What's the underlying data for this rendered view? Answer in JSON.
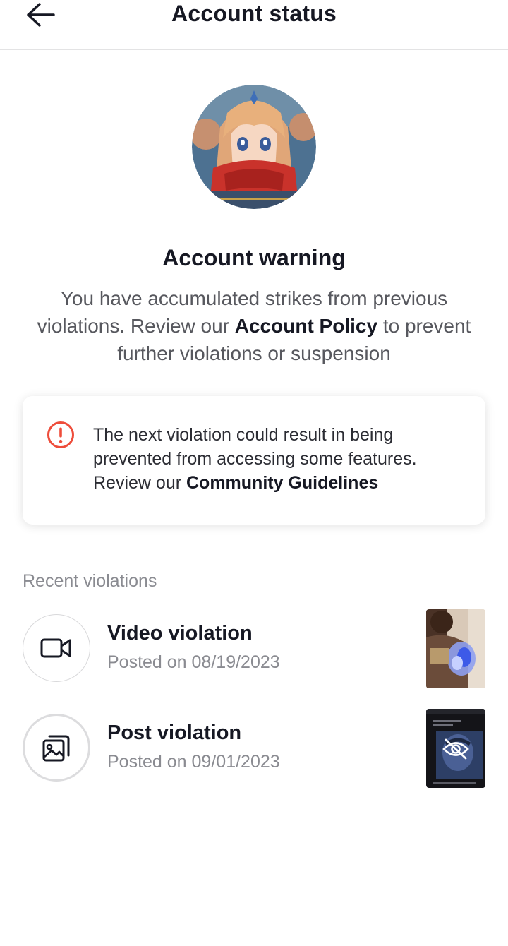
{
  "header": {
    "title": "Account status",
    "back_icon": "arrow-left-icon"
  },
  "avatar": {
    "icon": "anime-avatar"
  },
  "warning": {
    "title": "Account warning",
    "desc_part1": "You have accumulated strikes from previous violations. Review our ",
    "policy_link": "Account Policy",
    "desc_part2": " to prevent further violations or suspension"
  },
  "notice": {
    "icon": "exclamation-circle-icon",
    "text_part1": "The next violation could result in being prevented from accessing some features. Review our ",
    "guidelines_link": "Community Guidelines",
    "alert_color": "#fe2c55"
  },
  "recent": {
    "label": "Recent violations",
    "items": [
      {
        "title": "Video violation",
        "date": "Posted on 08/19/2023",
        "icon": "video-camera-icon"
      },
      {
        "title": "Post violation",
        "date": "Posted on 09/01/2023",
        "icon": "photo-stack-icon"
      }
    ]
  }
}
